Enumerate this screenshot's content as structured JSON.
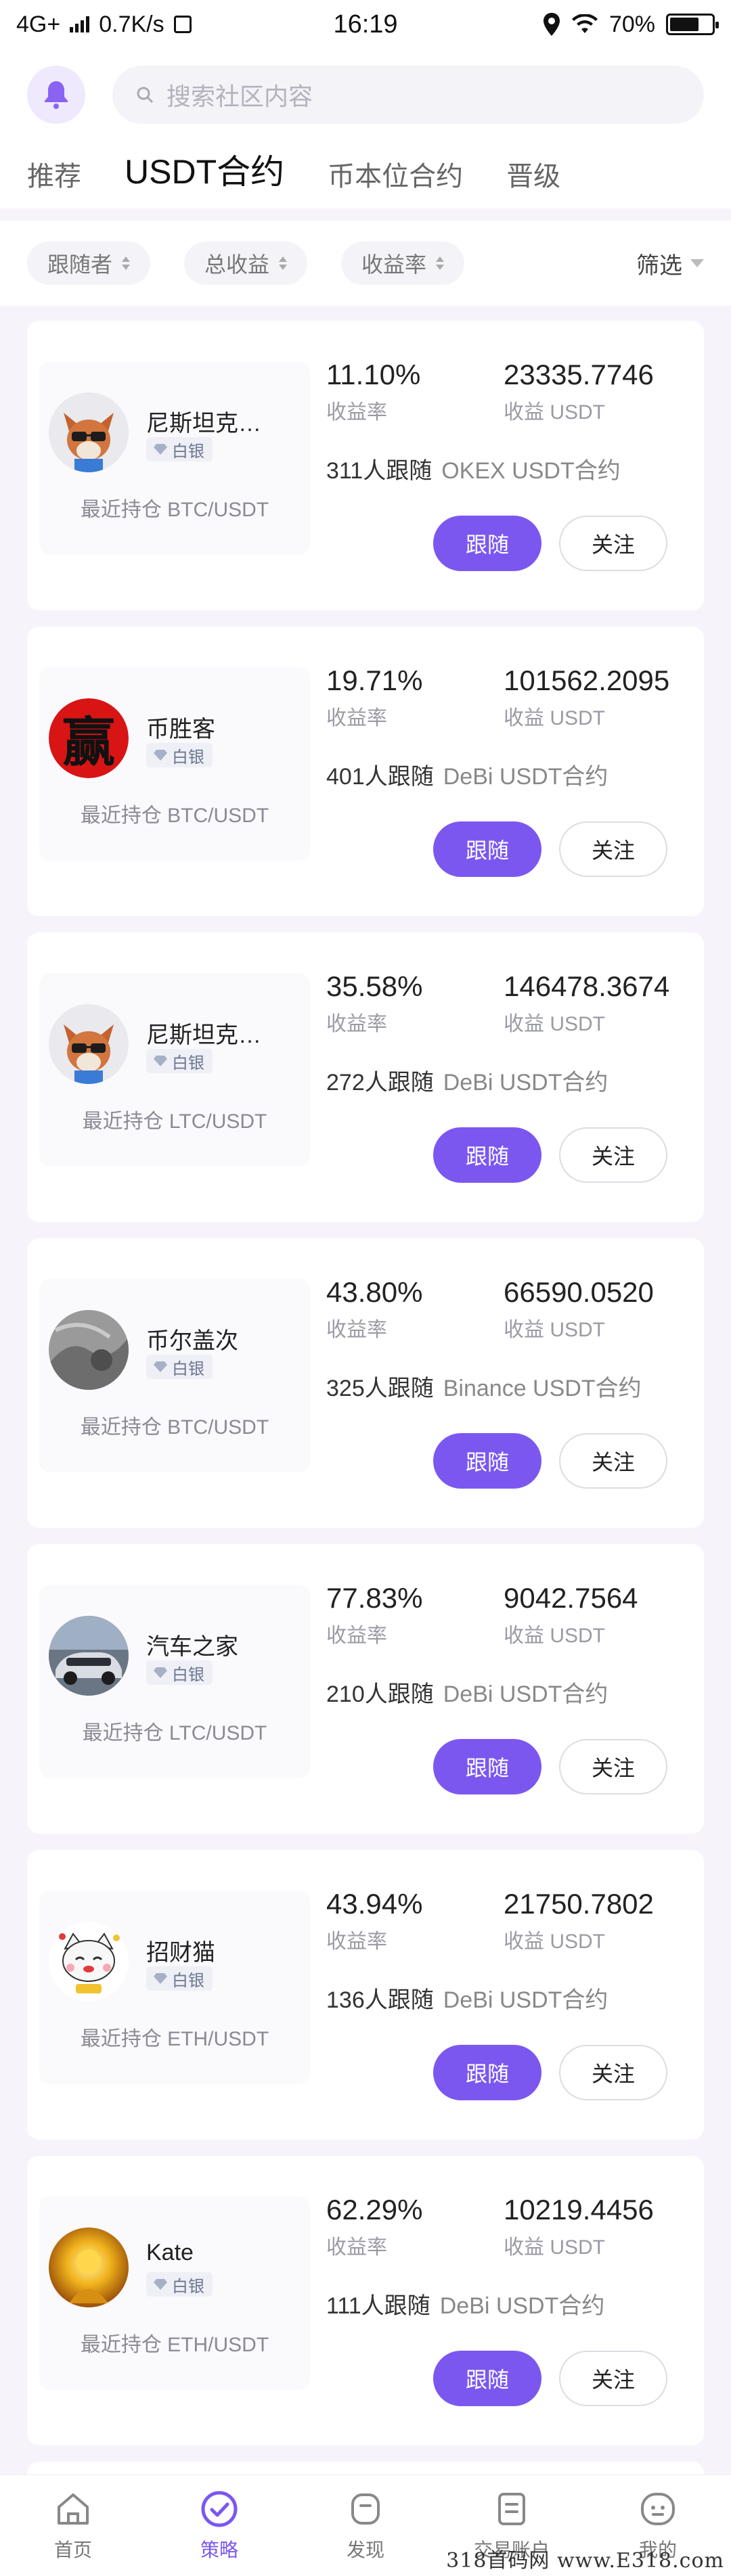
{
  "statusbar": {
    "network": "4G+",
    "speed": "0.7K/s",
    "time": "16:19",
    "battery": "70%",
    "battery_level": 0.7
  },
  "search": {
    "placeholder": "搜索社区内容"
  },
  "tabs": [
    {
      "label": "推荐"
    },
    {
      "label": "USDT合约"
    },
    {
      "label": "币本位合约"
    },
    {
      "label": "晋级"
    }
  ],
  "filters": {
    "sort1": "跟随者",
    "sort2": "总收益",
    "sort3": "收益率",
    "filter": "筛选"
  },
  "labels": {
    "rate": "收益率",
    "profit": "收益 USDT",
    "follow": "跟随",
    "watch": "关注"
  },
  "traders": [
    {
      "name": "尼斯坦克…",
      "badge": "白银",
      "holding": "最近持仓 BTC/USDT",
      "rate": "11.10%",
      "profit": "23335.7746",
      "followers": "311人跟随",
      "exchange": "OKEX USDT合约",
      "avatar": "fox-avatar"
    },
    {
      "name": "币胜客",
      "badge": "白银",
      "holding": "最近持仓 BTC/USDT",
      "rate": "19.71%",
      "profit": "101562.2095",
      "followers": "401人跟随",
      "exchange": "DeBi USDT合约",
      "avatar": "win-character-avatar",
      "avatar_text": "赢"
    },
    {
      "name": "尼斯坦克…",
      "badge": "白银",
      "holding": "最近持仓 LTC/USDT",
      "rate": "35.58%",
      "profit": "146478.3674",
      "followers": "272人跟随",
      "exchange": "DeBi USDT合约",
      "avatar": "fox-avatar"
    },
    {
      "name": "币尔盖次",
      "badge": "白银",
      "holding": "最近持仓 BTC/USDT",
      "rate": "43.80%",
      "profit": "66590.0520",
      "followers": "325人跟随",
      "exchange": "Binance USDT合约",
      "avatar": "gray-photo-avatar"
    },
    {
      "name": "汽车之家",
      "badge": "白银",
      "holding": "最近持仓 LTC/USDT",
      "rate": "77.83%",
      "profit": "9042.7564",
      "followers": "210人跟随",
      "exchange": "DeBi USDT合约",
      "avatar": "car-avatar"
    },
    {
      "name": "招财猫",
      "badge": "白银",
      "holding": "最近持仓 ETH/USDT",
      "rate": "43.94%",
      "profit": "21750.7802",
      "followers": "136人跟随",
      "exchange": "DeBi USDT合约",
      "avatar": "lucky-cat-avatar"
    },
    {
      "name": "Kate",
      "badge": "白银",
      "holding": "最近持仓 ETH/USDT",
      "rate": "62.29%",
      "profit": "10219.4456",
      "followers": "111人跟随",
      "exchange": "DeBi USDT合约",
      "avatar": "golden-avatar"
    }
  ],
  "nav": [
    {
      "label": "首页",
      "icon": "home-icon"
    },
    {
      "label": "策略",
      "icon": "strategy-icon"
    },
    {
      "label": "发现",
      "icon": "discover-icon"
    },
    {
      "label": "交易账户",
      "icon": "account-icon"
    },
    {
      "label": "我的",
      "icon": "profile-icon"
    }
  ],
  "watermark": "318首码网 www.E318.com",
  "colors": {
    "accent": "#7b57f0",
    "background": "#f6f4fa"
  }
}
